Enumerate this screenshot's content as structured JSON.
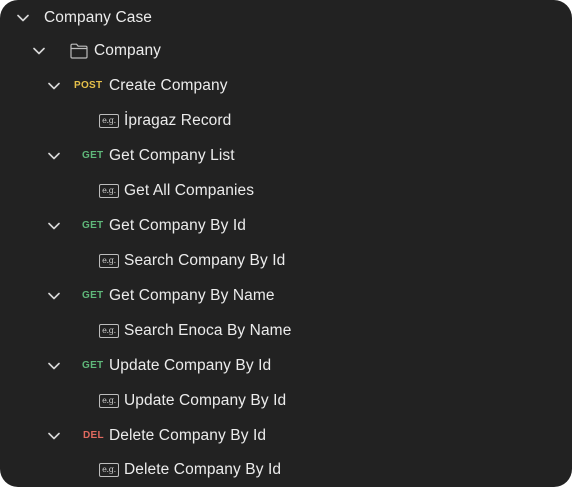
{
  "tree": {
    "root": {
      "label": "Company Case"
    },
    "folder": {
      "label": "Company"
    },
    "requests": [
      {
        "method": "POST",
        "label": "Create Company",
        "example": {
          "icon": "e.g.",
          "label": "İpragaz Record"
        }
      },
      {
        "method": "GET",
        "label": "Get Company List",
        "example": {
          "icon": "e.g.",
          "label": "Get All Companies"
        }
      },
      {
        "method": "GET",
        "label": "Get Company By Id",
        "example": {
          "icon": "e.g.",
          "label": "Search Company By Id"
        }
      },
      {
        "method": "GET",
        "label": "Get Company By Name",
        "example": {
          "icon": "e.g.",
          "label": "Search Enoca By Name"
        }
      },
      {
        "method": "GET",
        "label": "Update Company By Id",
        "example": {
          "icon": "e.g.",
          "label": "Update Company By Id"
        }
      },
      {
        "method": "DEL",
        "label": "Delete Company By Id",
        "example": {
          "icon": "e.g.",
          "label": "Delete Company By Id"
        }
      }
    ]
  },
  "icons": {
    "chevron": "chevron-down-icon",
    "folder": "folder-icon",
    "example": "example-icon"
  },
  "colors": {
    "background": "#222222",
    "text": "#ececec",
    "post": "#e5c04a",
    "get": "#5fb87a",
    "del": "#e06a5f"
  }
}
